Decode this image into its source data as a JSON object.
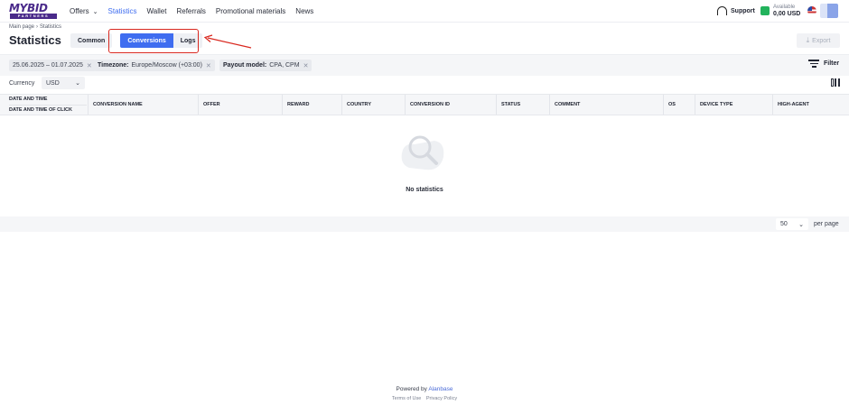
{
  "logo": {
    "top": "MYBID",
    "bottom": "PARTNERS"
  },
  "nav": {
    "items": [
      "Offers",
      "Statistics",
      "Wallet",
      "Referrals",
      "Promotional materials",
      "News"
    ],
    "active": "Statistics"
  },
  "header": {
    "support_label": "Support",
    "available_label": "Available",
    "balance": "0,00 USD"
  },
  "breadcrumb": {
    "home": "Main page",
    "current": "Statistics"
  },
  "page_title": "Statistics",
  "tabs": {
    "common": "Common",
    "conversions": "Conversions",
    "logs": "Logs"
  },
  "export_label": "Export",
  "filters": {
    "date_range": "25.06.2025 – 01.07.2025",
    "timezone_label": "Timezone:",
    "timezone_value": "Europe/Moscow (+03:00)",
    "payout_label": "Payout model:",
    "payout_value": "CPA, CPM",
    "filter_button": "Filter"
  },
  "currency": {
    "label": "Currency",
    "value": "USD"
  },
  "table": {
    "first_col": [
      "DATE AND TIME",
      "DATE AND TIME OF CLICK"
    ],
    "columns": [
      "CONVERSION NAME",
      "OFFER",
      "REWARD",
      "COUNTRY",
      "CONVERSION ID",
      "STATUS",
      "COMMENT",
      "OS",
      "DEVICE TYPE",
      "HIGH-AGENT"
    ],
    "empty_text": "No statistics"
  },
  "pagination": {
    "per_page_value": "50",
    "per_page_label": "per page"
  },
  "footer": {
    "powered_by": "Powered by",
    "brand": "Alanbase",
    "terms": "Terms of Use",
    "privacy": "Privacy Policy"
  },
  "colors": {
    "accent": "#3f6df0",
    "highlight": "#d9281f",
    "brand": "#4a2a8a"
  }
}
